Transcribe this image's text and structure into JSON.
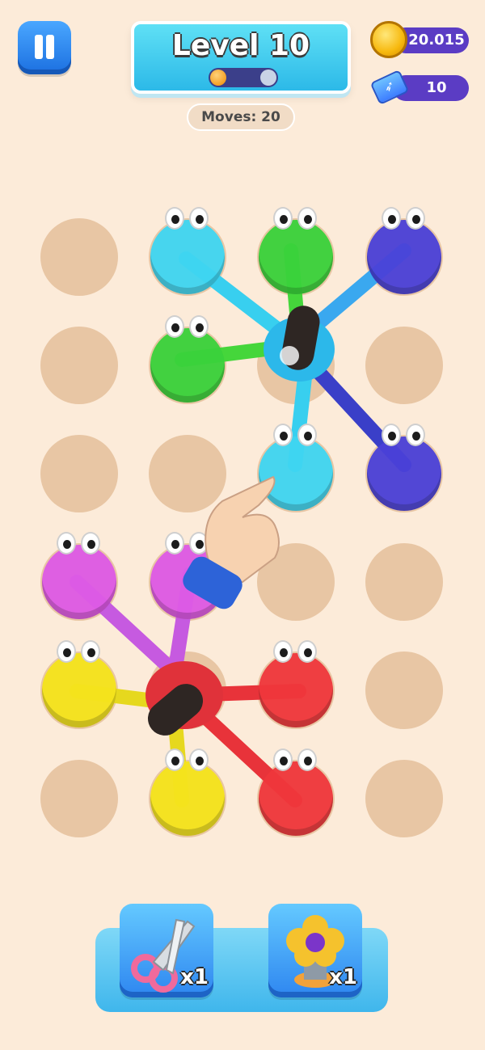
{
  "hud": {
    "level_title": "Level 10",
    "moves_text": "Moves: 20",
    "coins": "20.015",
    "tickets": "10",
    "level_progress": 0.5
  },
  "boosters": [
    {
      "name": "scissors",
      "count_label": "x1"
    },
    {
      "name": "flower-pin",
      "count_label": "x1"
    }
  ],
  "colors": {
    "background": "#fcebd9",
    "hole": "#e8c6a4",
    "cyan": "#3fd6f2",
    "green": "#3ad23b",
    "blue": "#4a41d8",
    "magenta": "#de5ae6",
    "yellow": "#f5e41c",
    "red": "#f0373c"
  },
  "board": {
    "rows": 6,
    "cols": 4,
    "pegs": [
      {
        "row": 0,
        "col": 1,
        "color": "cyan"
      },
      {
        "row": 0,
        "col": 2,
        "color": "green"
      },
      {
        "row": 0,
        "col": 3,
        "color": "blue"
      },
      {
        "row": 1,
        "col": 1,
        "color": "green"
      },
      {
        "row": 2,
        "col": 2,
        "color": "cyan"
      },
      {
        "row": 2,
        "col": 3,
        "color": "blue"
      },
      {
        "row": 3,
        "col": 0,
        "color": "magenta"
      },
      {
        "row": 3,
        "col": 1,
        "color": "magenta"
      },
      {
        "row": 4,
        "col": 0,
        "color": "yellow"
      },
      {
        "row": 4,
        "col": 2,
        "color": "red"
      },
      {
        "row": 5,
        "col": 1,
        "color": "yellow"
      },
      {
        "row": 5,
        "col": 2,
        "color": "red"
      }
    ]
  }
}
